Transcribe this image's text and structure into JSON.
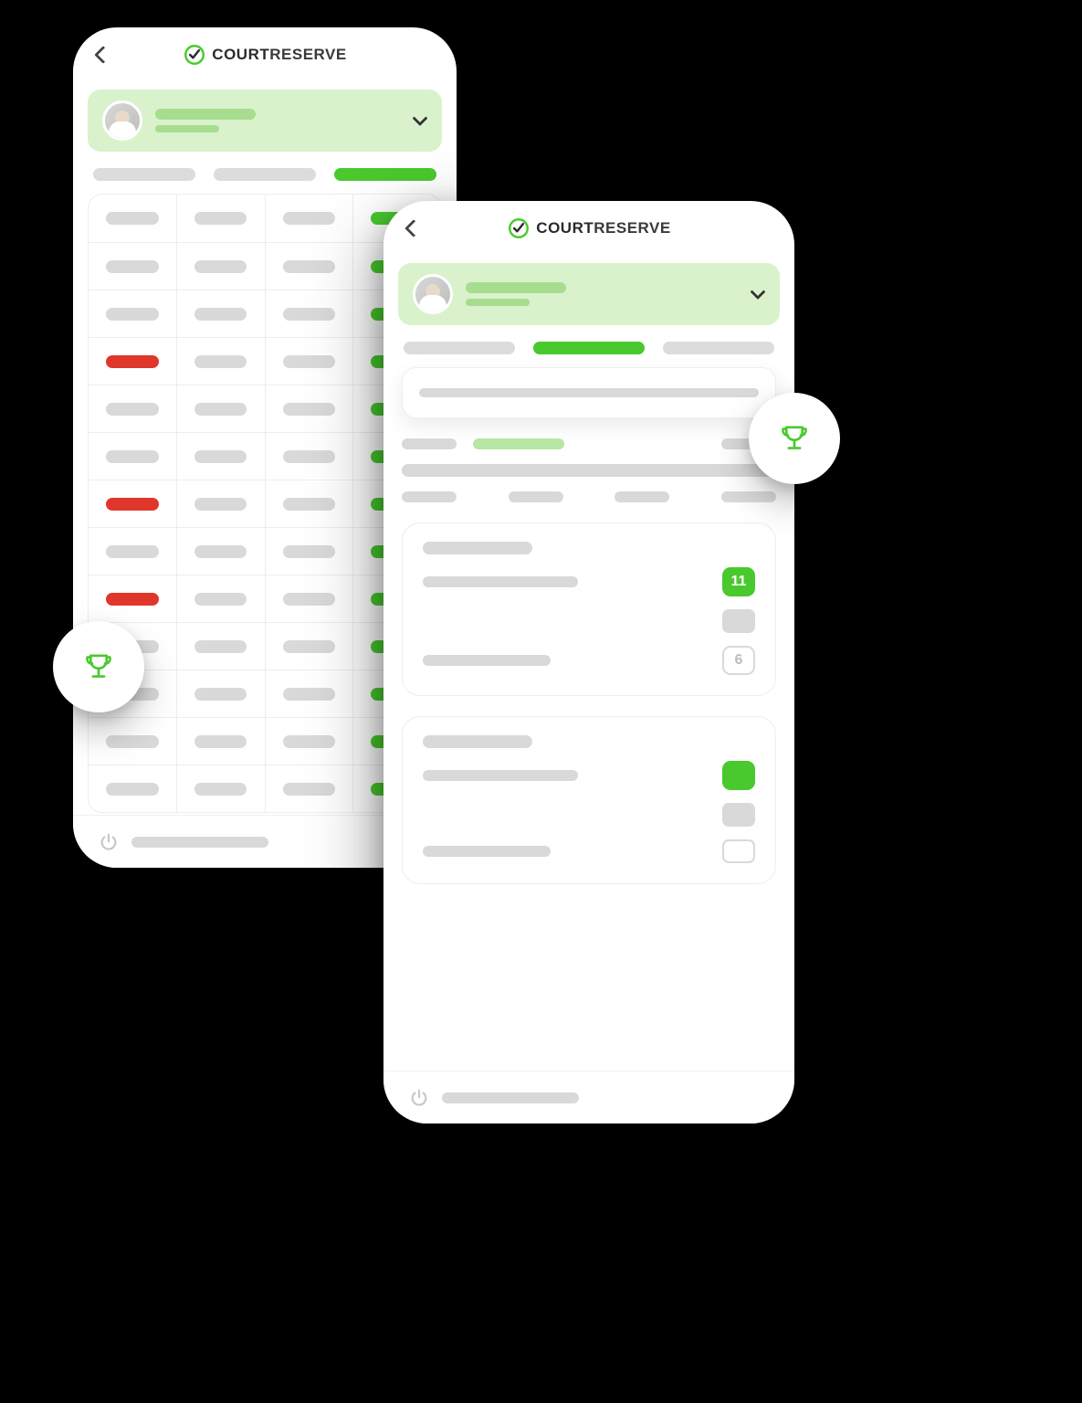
{
  "brand": {
    "name_left": "COURT",
    "name_right": "RESERVE"
  },
  "back_phone": {
    "tabs": {
      "active_index": 2
    },
    "table": [
      [
        "grey",
        "grey",
        "grey",
        "green"
      ],
      [
        "grey",
        "grey",
        "grey",
        "green"
      ],
      [
        "grey",
        "grey",
        "grey",
        "green"
      ],
      [
        "red",
        "grey",
        "grey",
        "green"
      ],
      [
        "grey",
        "grey",
        "grey",
        "green"
      ],
      [
        "grey",
        "grey",
        "grey",
        "green"
      ],
      [
        "red",
        "grey",
        "grey",
        "green"
      ],
      [
        "grey",
        "grey",
        "grey",
        "green"
      ],
      [
        "red",
        "grey",
        "grey",
        "green"
      ],
      [
        "grey",
        "grey",
        "grey",
        "green"
      ],
      [
        "grey",
        "grey",
        "grey",
        "green"
      ],
      [
        "grey",
        "grey",
        "grey",
        "green"
      ],
      [
        "grey",
        "grey",
        "grey",
        "green"
      ]
    ]
  },
  "front_phone": {
    "tabs": {
      "active_index": 1
    },
    "card1": {
      "badge_value": "11",
      "secondary_badge_value": "6"
    },
    "card2": {
      "badge_value": "",
      "secondary_badge_value": ""
    }
  }
}
